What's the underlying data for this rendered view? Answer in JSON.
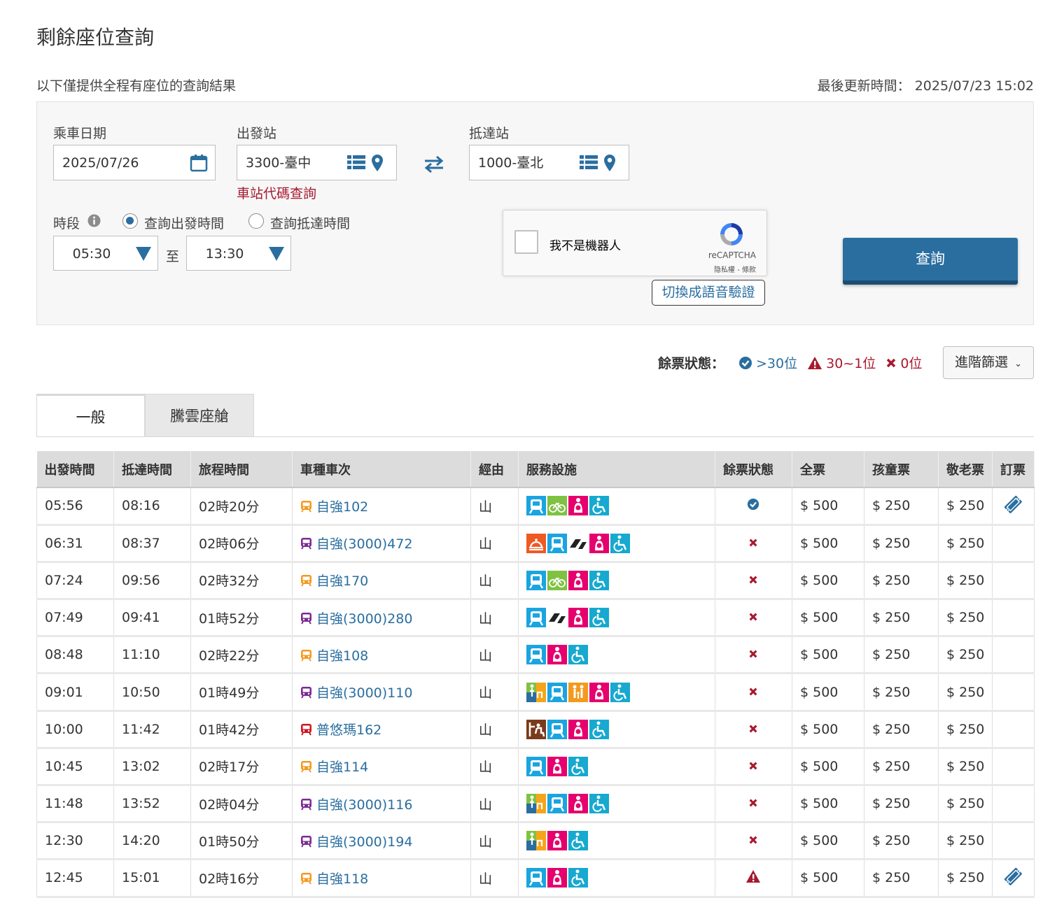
{
  "page": {
    "title": "剩餘座位查詢",
    "subtitle": "以下僅提供全程有座位的查詢結果",
    "update_label": "最後更新時間：",
    "update_time": "2025/07/23 15:02"
  },
  "form": {
    "date_label": "乘車日期",
    "date_value": "2025/07/26",
    "from_label": "出發站",
    "from_value": "3300-臺中",
    "to_label": "抵達站",
    "to_value": "1000-臺北",
    "station_code_link": "車站代碼查詢",
    "period_label": "時段",
    "radio_depart": "查詢出發時間",
    "radio_arrive": "查詢抵達時間",
    "time_from": "05:30",
    "time_sep": "至",
    "time_to": "13:30",
    "recaptcha_text": "我不是機器人",
    "recaptcha_brand": "reCAPTCHA",
    "recaptcha_terms": "隐私權 - 條款",
    "audio_button": "切換成語音驗證",
    "search_button": "查詢"
  },
  "legend": {
    "title": "餘票狀態：",
    "many": ">30位",
    "few": "30~1位",
    "none": "0位",
    "filter_button": "進階篩選"
  },
  "tabs": [
    "一般",
    "騰雲座艙"
  ],
  "colors": {
    "primary": "#2a6ea0",
    "red": "#a7192f",
    "orange_train": "#f39a1e",
    "purple_train": "#7b2a90",
    "red_train": "#d0141e"
  },
  "table": {
    "headers": [
      "出發時間",
      "抵達時間",
      "旅程時間",
      "車種車次",
      "經由",
      "服務設施",
      "餘票狀態",
      "全票",
      "孩童票",
      "敬老票",
      "訂票"
    ],
    "rows": [
      {
        "dep": "05:56",
        "arr": "08:16",
        "dur": "02時20分",
        "train": "自強102",
        "kind": "orange",
        "via": "山",
        "svc": [
          "seat",
          "bike",
          "nursing",
          "wheelchair"
        ],
        "status": "ok",
        "full": "$ 500",
        "child": "$ 250",
        "senior": "$ 250",
        "book": true
      },
      {
        "dep": "06:31",
        "arr": "08:37",
        "dur": "02時06分",
        "train": "自強(3000)472",
        "kind": "purple",
        "via": "山",
        "svc": [
          "meal",
          "seat",
          "lounge",
          "nursing",
          "wheelchair"
        ],
        "status": "none",
        "full": "$ 500",
        "child": "$ 250",
        "senior": "$ 250",
        "book": false
      },
      {
        "dep": "07:24",
        "arr": "09:56",
        "dur": "02時32分",
        "train": "自強170",
        "kind": "orange",
        "via": "山",
        "svc": [
          "seat",
          "bike",
          "nursing",
          "wheelchair"
        ],
        "status": "none",
        "full": "$ 500",
        "child": "$ 250",
        "senior": "$ 250",
        "book": false
      },
      {
        "dep": "07:49",
        "arr": "09:41",
        "dur": "01時52分",
        "train": "自強(3000)280",
        "kind": "purple",
        "via": "山",
        "svc": [
          "seat",
          "lounge",
          "nursing",
          "wheelchair"
        ],
        "status": "none",
        "full": "$ 500",
        "child": "$ 250",
        "senior": "$ 250",
        "book": false
      },
      {
        "dep": "08:48",
        "arr": "11:10",
        "dur": "02時22分",
        "train": "自強108",
        "kind": "orange",
        "via": "山",
        "svc": [
          "seat",
          "nursing",
          "wheelchair"
        ],
        "status": "none",
        "full": "$ 500",
        "child": "$ 250",
        "senior": "$ 250",
        "book": false
      },
      {
        "dep": "09:01",
        "arr": "10:50",
        "dur": "01時49分",
        "train": "自強(3000)110",
        "kind": "purple",
        "via": "山",
        "svc": [
          "business",
          "seat",
          "family",
          "nursing",
          "wheelchair"
        ],
        "status": "none",
        "full": "$ 500",
        "child": "$ 250",
        "senior": "$ 250",
        "book": false
      },
      {
        "dep": "10:00",
        "arr": "11:42",
        "dur": "01時42分",
        "train": "普悠瑪162",
        "kind": "red",
        "via": "山",
        "svc": [
          "standing",
          "seat",
          "nursing",
          "wheelchair"
        ],
        "status": "none",
        "full": "$ 500",
        "child": "$ 250",
        "senior": "$ 250",
        "book": false
      },
      {
        "dep": "10:45",
        "arr": "13:02",
        "dur": "02時17分",
        "train": "自強114",
        "kind": "orange",
        "via": "山",
        "svc": [
          "seat",
          "nursing",
          "wheelchair"
        ],
        "status": "none",
        "full": "$ 500",
        "child": "$ 250",
        "senior": "$ 250",
        "book": false
      },
      {
        "dep": "11:48",
        "arr": "13:52",
        "dur": "02時04分",
        "train": "自強(3000)116",
        "kind": "purple",
        "via": "山",
        "svc": [
          "business",
          "seat",
          "nursing",
          "wheelchair"
        ],
        "status": "none",
        "full": "$ 500",
        "child": "$ 250",
        "senior": "$ 250",
        "book": false
      },
      {
        "dep": "12:30",
        "arr": "14:20",
        "dur": "01時50分",
        "train": "自強(3000)194",
        "kind": "purple",
        "via": "山",
        "svc": [
          "business",
          "nursing",
          "wheelchair"
        ],
        "status": "none",
        "full": "$ 500",
        "child": "$ 250",
        "senior": "$ 250",
        "book": false
      },
      {
        "dep": "12:45",
        "arr": "15:01",
        "dur": "02時16分",
        "train": "自強118",
        "kind": "orange",
        "via": "山",
        "svc": [
          "seat",
          "nursing",
          "wheelchair"
        ],
        "status": "few",
        "full": "$ 500",
        "child": "$ 250",
        "senior": "$ 250",
        "book": true
      }
    ]
  }
}
